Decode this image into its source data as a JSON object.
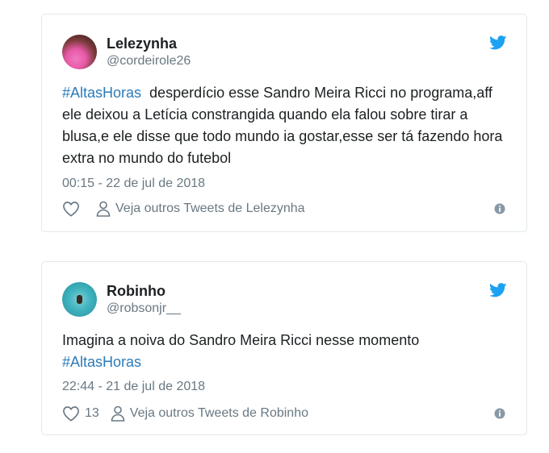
{
  "tweets": [
    {
      "name": "Lelezynha",
      "handle": "@cordeirole26",
      "hashtag_start": "#AltasHoras",
      "body": "  desperdício esse Sandro Meira Ricci no programa,aff ele deixou a Letícia constrangida quando ela falou sobre tirar a blusa,e ele disse que todo mundo ia gostar,esse ser tá fazendo hora extra no mundo do futebol",
      "timestamp": "00:15 - 22 de jul de 2018",
      "likes": "",
      "more_label": "Veja outros Tweets de Lelezynha"
    },
    {
      "name": "Robinho",
      "handle": "@robsonjr__",
      "body": "Imagina a noiva do Sandro Meira Ricci nesse momento ",
      "hashtag_end": "#AltasHoras",
      "timestamp": "22:44 - 21 de jul de 2018",
      "likes": "13",
      "more_label": "Veja outros Tweets de Robinho"
    }
  ],
  "colors": {
    "accent": "#1da1f2",
    "hashtag": "#2b7bb9",
    "muted": "#697882",
    "border": "#e1e8ed"
  },
  "icons": [
    "twitter-bird-icon",
    "heart-icon",
    "person-icon",
    "info-icon"
  ]
}
